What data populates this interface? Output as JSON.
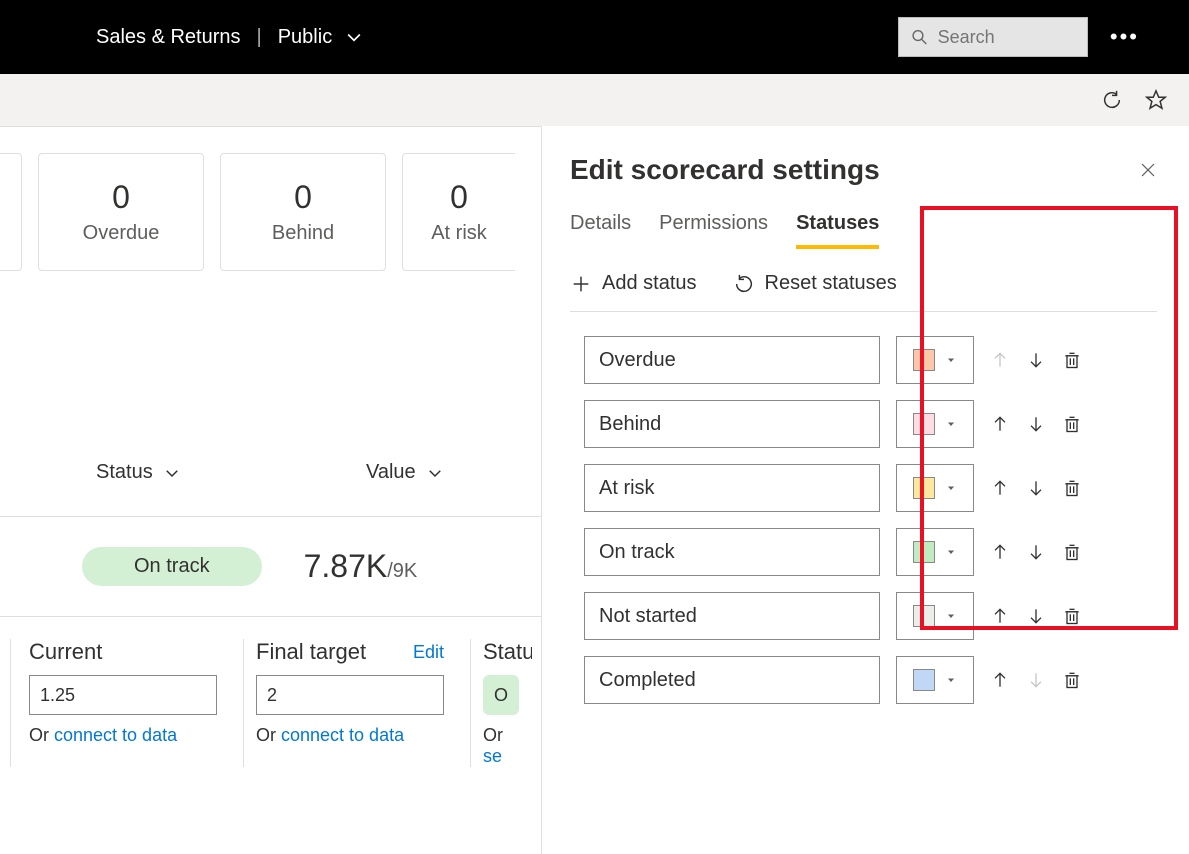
{
  "header": {
    "workspace_name": "Sales & Returns",
    "visibility": "Public",
    "search_placeholder": "Search"
  },
  "cards": [
    {
      "value": "0",
      "label": "Overdue"
    },
    {
      "value": "0",
      "label": "Behind"
    },
    {
      "value": "0",
      "label": "At risk"
    }
  ],
  "table_headers": {
    "status": "Status",
    "value": "Value"
  },
  "status_pill": "On track",
  "big_value": "7.87K",
  "big_value_denom": "/9K",
  "edit_cards": {
    "current": {
      "title": "Current",
      "value": "1.25",
      "or": "Or ",
      "link": "connect to data"
    },
    "final_target": {
      "title": "Final target",
      "edit": "Edit",
      "value": "2",
      "or": "Or ",
      "link": "connect to data"
    },
    "status": {
      "title": "Statu",
      "chip": "O",
      "or": "Or ",
      "link": "se"
    }
  },
  "panel": {
    "title": "Edit scorecard settings",
    "tabs": [
      "Details",
      "Permissions",
      "Statuses"
    ],
    "active_tab": 2,
    "actions": {
      "add": "Add status",
      "reset": "Reset statuses"
    },
    "statuses": [
      {
        "name": "Overdue",
        "color": "#fbc7a8",
        "up_disabled": true,
        "down_disabled": false
      },
      {
        "name": "Behind",
        "color": "#fddde3",
        "up_disabled": false,
        "down_disabled": false
      },
      {
        "name": "At risk",
        "color": "#fde79c",
        "up_disabled": false,
        "down_disabled": false
      },
      {
        "name": "On track",
        "color": "#c0eac0",
        "up_disabled": false,
        "down_disabled": false
      },
      {
        "name": "Not started",
        "color": "#ecece9",
        "up_disabled": false,
        "down_disabled": false
      },
      {
        "name": "Completed",
        "color": "#c0d8f5",
        "up_disabled": false,
        "down_disabled": true
      }
    ]
  }
}
